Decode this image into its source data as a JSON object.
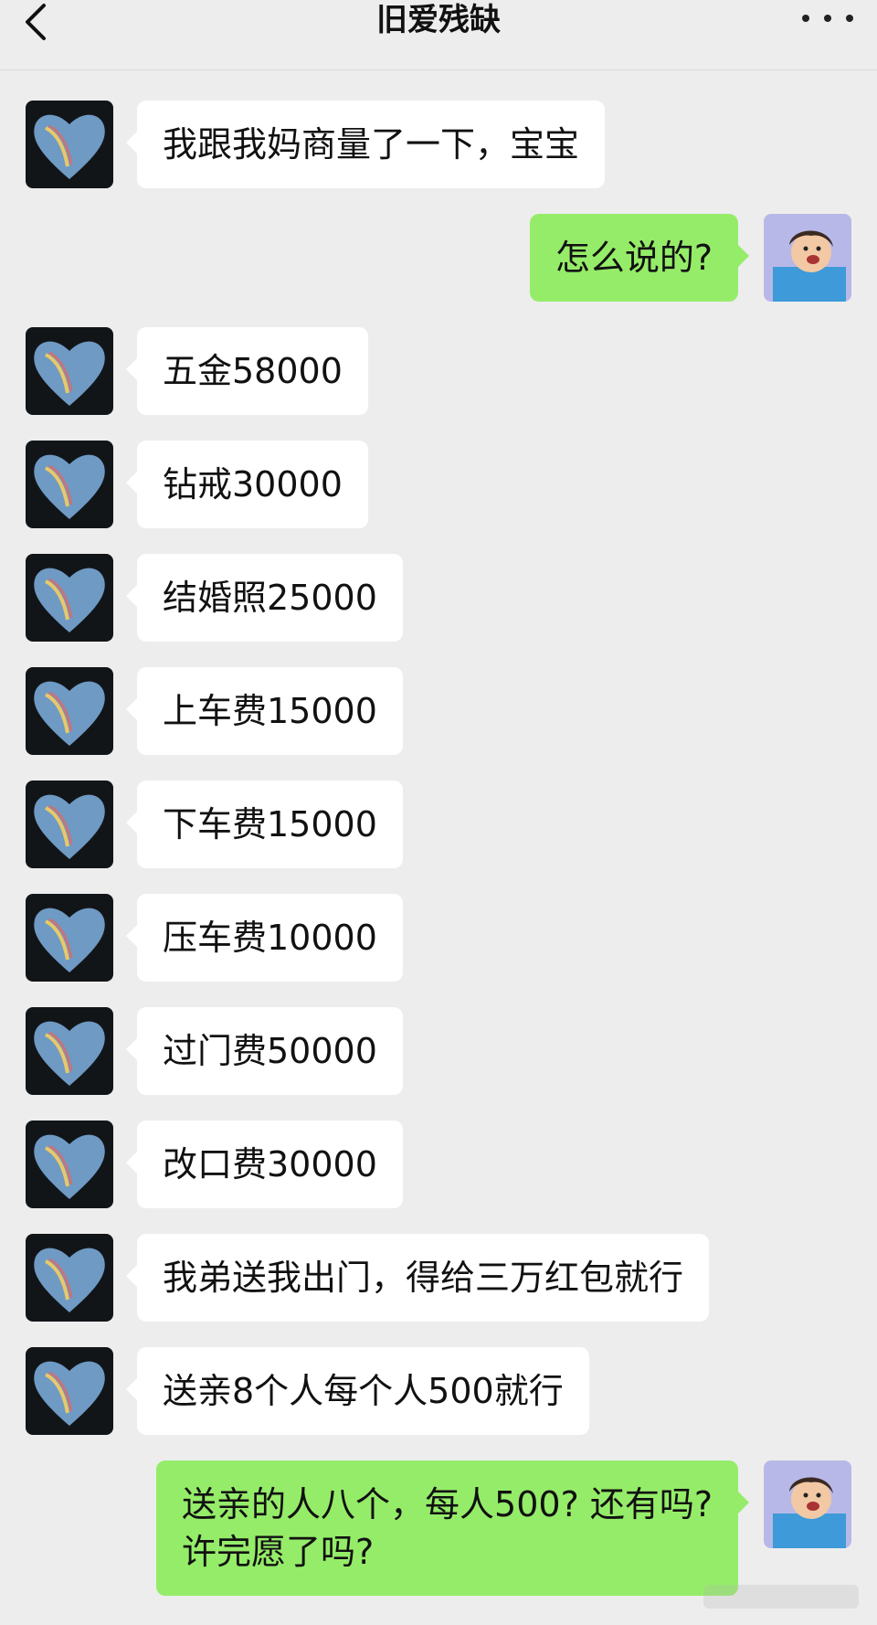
{
  "header": {
    "title": "旧爱残缺",
    "back_icon": "chevron-left-icon",
    "more_icon": "more-dots-icon"
  },
  "colors": {
    "background": "#ededed",
    "incoming_bubble": "#ffffff",
    "outgoing_bubble": "#95ec69"
  },
  "messages": [
    {
      "side": "left",
      "text": "我跟我妈商量了一下，宝宝"
    },
    {
      "side": "right",
      "text": "怎么说的?"
    },
    {
      "side": "left",
      "text": "五金58000"
    },
    {
      "side": "left",
      "text": "钻戒30000"
    },
    {
      "side": "left",
      "text": "结婚照25000"
    },
    {
      "side": "left",
      "text": "上车费15000"
    },
    {
      "side": "left",
      "text": "下车费15000"
    },
    {
      "side": "left",
      "text": "压车费10000"
    },
    {
      "side": "left",
      "text": "过门费50000"
    },
    {
      "side": "left",
      "text": "改口费30000"
    },
    {
      "side": "left",
      "text": "我弟送我出门，得给三万红包就行"
    },
    {
      "side": "left",
      "text": "送亲8个人每个人500就行"
    },
    {
      "side": "right",
      "text": "送亲的人八个，每人500? 还有吗?\n许完愿了吗?"
    }
  ]
}
